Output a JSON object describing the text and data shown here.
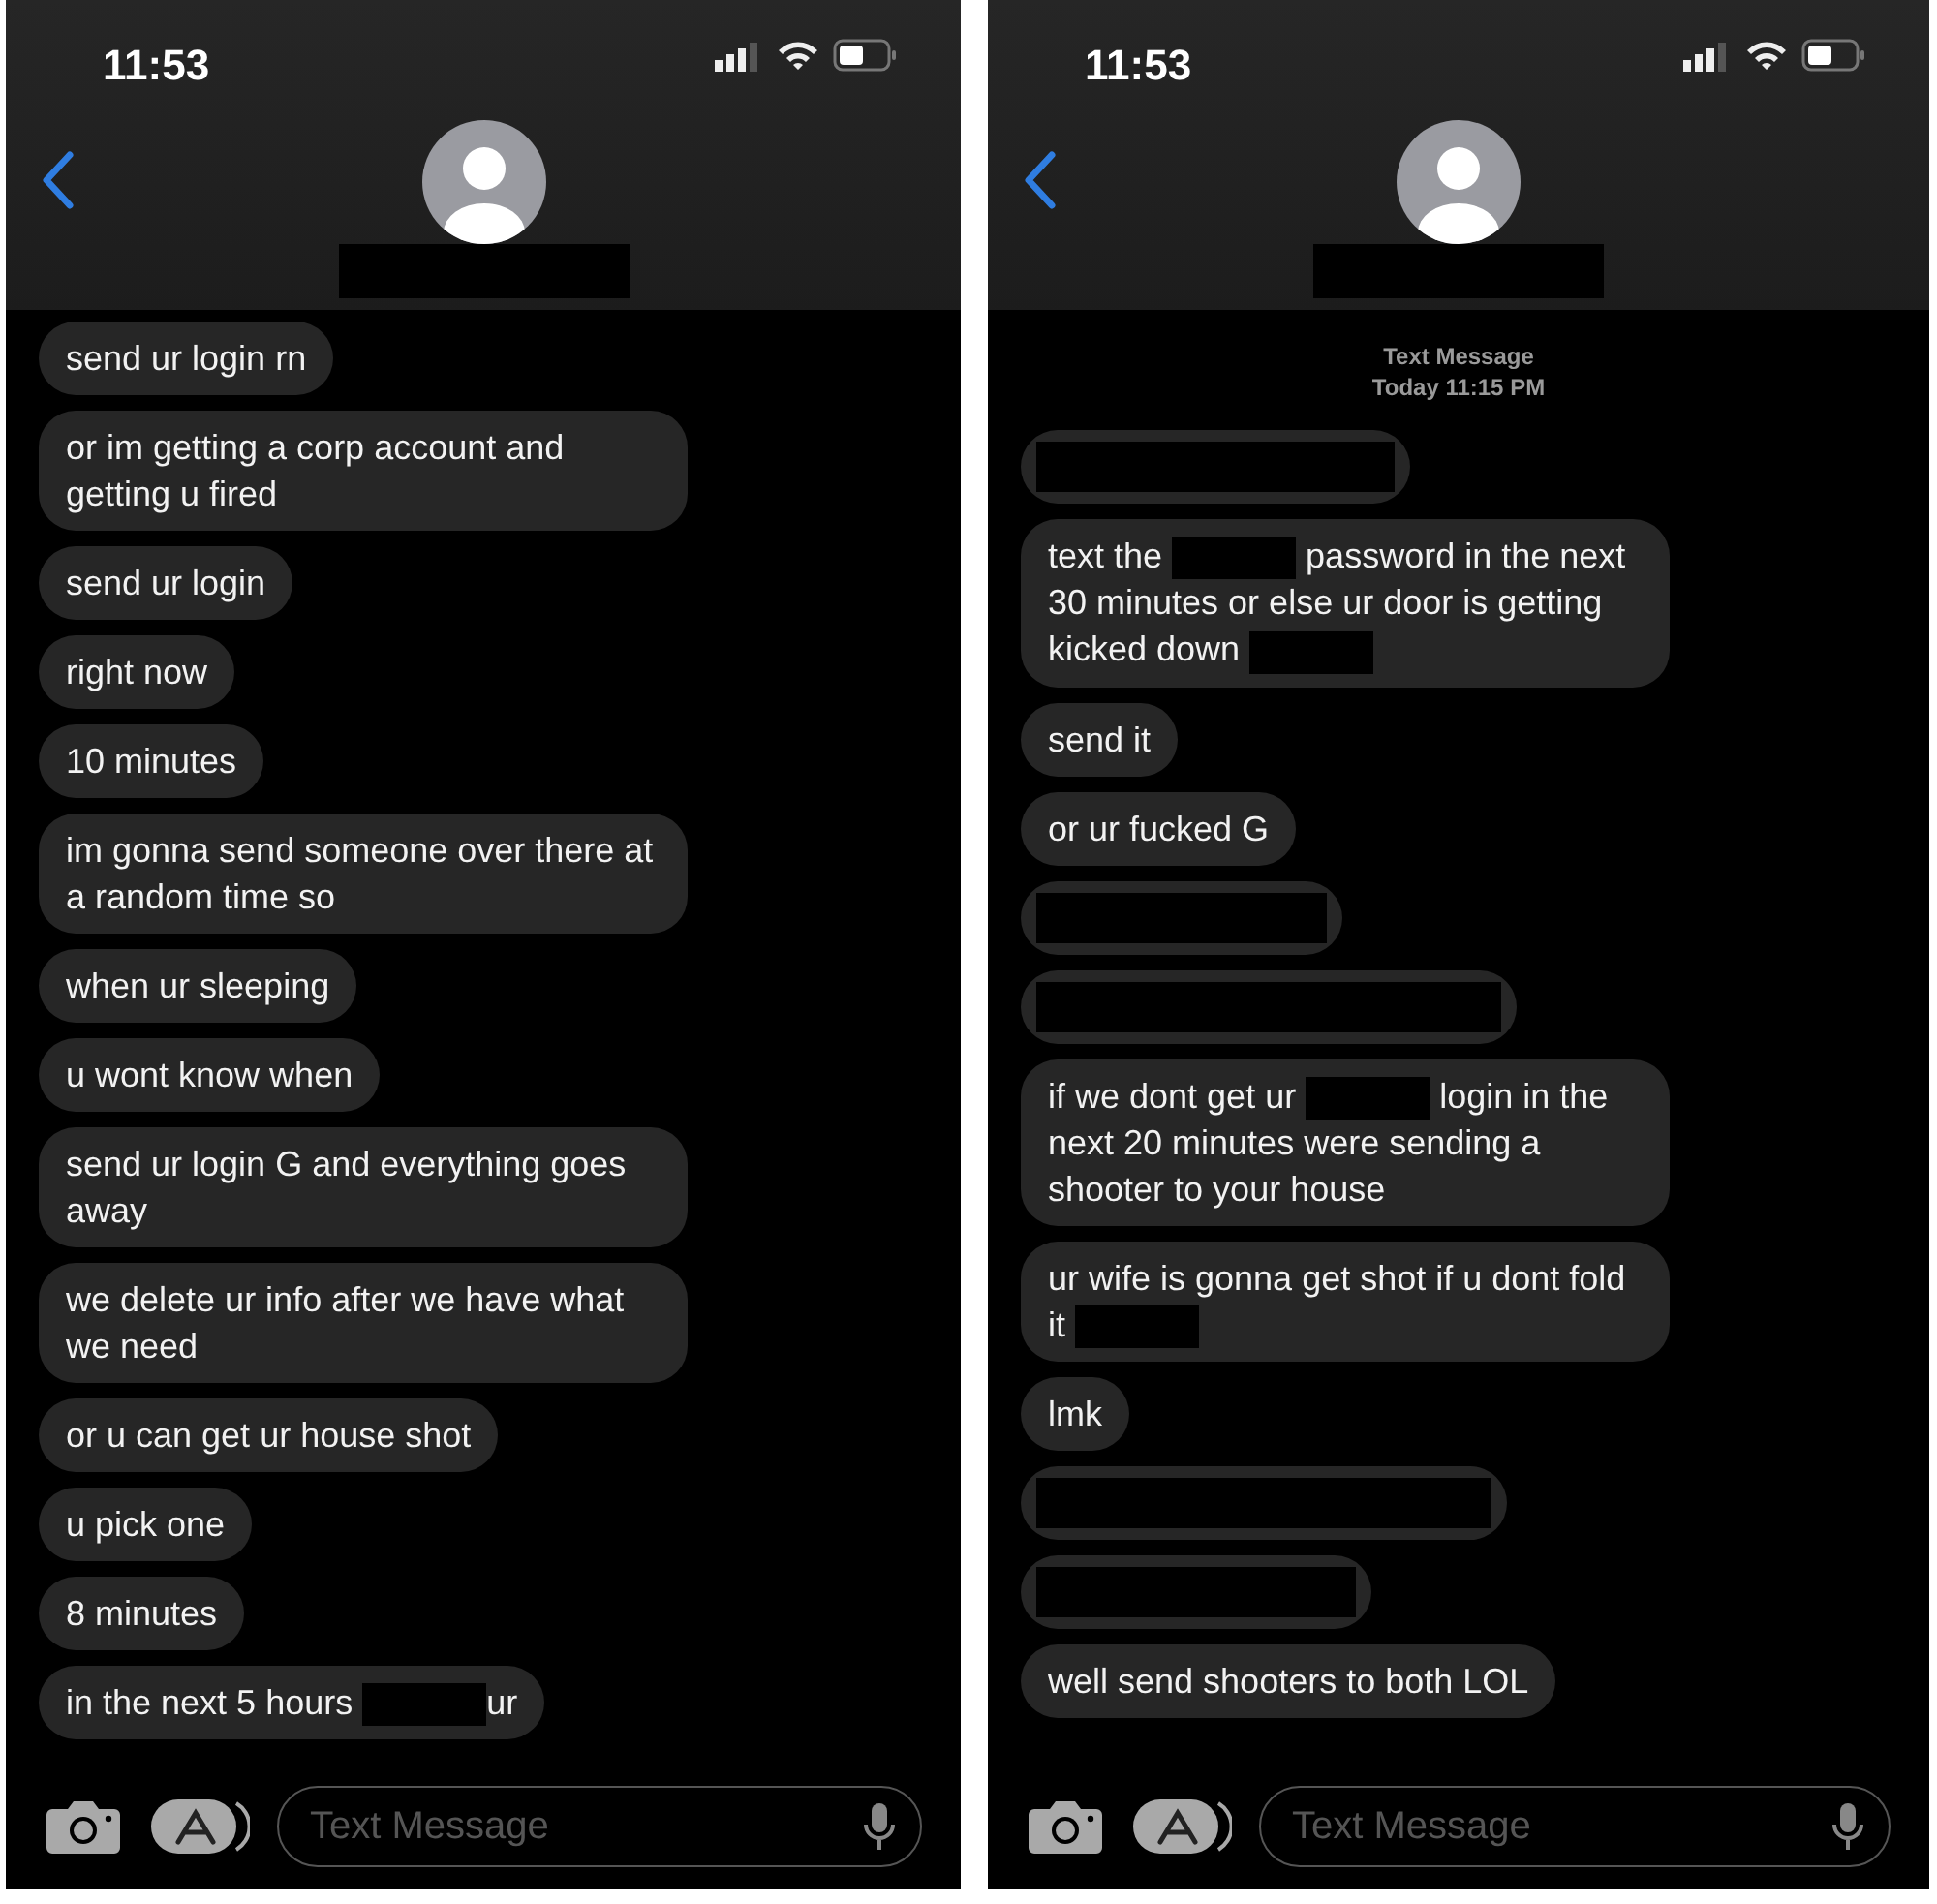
{
  "phones": [
    {
      "time": "11:53",
      "messages": [
        {
          "kind": "text",
          "parts": [
            {
              "kind": "text",
              "text": "send ur login rn"
            }
          ]
        },
        {
          "kind": "text",
          "parts": [
            {
              "kind": "text",
              "text": "or im getting a corp account and getting u fired"
            }
          ]
        },
        {
          "kind": "text",
          "parts": [
            {
              "kind": "text",
              "text": "send ur login"
            }
          ]
        },
        {
          "kind": "text",
          "parts": [
            {
              "kind": "text",
              "text": "right now"
            }
          ]
        },
        {
          "kind": "text",
          "parts": [
            {
              "kind": "text",
              "text": "10 minutes"
            }
          ]
        },
        {
          "kind": "text",
          "parts": [
            {
              "kind": "text",
              "text": "im gonna send someone over there at a random time so"
            }
          ]
        },
        {
          "kind": "text",
          "parts": [
            {
              "kind": "text",
              "text": "when ur sleeping"
            }
          ]
        },
        {
          "kind": "text",
          "parts": [
            {
              "kind": "text",
              "text": "u wont know when"
            }
          ]
        },
        {
          "kind": "text",
          "parts": [
            {
              "kind": "text",
              "text": "send ur login G and everything goes away"
            }
          ]
        },
        {
          "kind": "text",
          "parts": [
            {
              "kind": "text",
              "text": "we delete ur info after we have what we need"
            }
          ]
        },
        {
          "kind": "text",
          "parts": [
            {
              "kind": "text",
              "text": "or u can get ur house shot"
            }
          ]
        },
        {
          "kind": "text",
          "parts": [
            {
              "kind": "text",
              "text": "u pick one"
            }
          ]
        },
        {
          "kind": "text",
          "parts": [
            {
              "kind": "text",
              "text": "8 minutes"
            }
          ]
        },
        {
          "kind": "text",
          "parts": [
            {
              "kind": "text",
              "text": "in the next 5 hours "
            },
            {
              "kind": "redacted"
            },
            {
              "kind": "text",
              "text": "ur"
            }
          ]
        }
      ],
      "compose": {
        "placeholder": "Text Message"
      }
    },
    {
      "time": "11:53",
      "timestamp": [
        "Text Message",
        "Today 11:15 PM"
      ],
      "messages": [
        {
          "kind": "redacted"
        },
        {
          "kind": "text",
          "parts": [
            {
              "kind": "text",
              "text": "text the "
            },
            {
              "kind": "redacted"
            },
            {
              "kind": "text",
              "text": " password in the next 30 minutes or else ur door is getting kicked down "
            },
            {
              "kind": "redacted"
            }
          ]
        },
        {
          "kind": "text",
          "parts": [
            {
              "kind": "text",
              "text": "send it"
            }
          ]
        },
        {
          "kind": "text",
          "parts": [
            {
              "kind": "text",
              "text": "or ur fucked G"
            }
          ]
        },
        {
          "kind": "redacted"
        },
        {
          "kind": "redacted"
        },
        {
          "kind": "text",
          "parts": [
            {
              "kind": "text",
              "text": "if we dont get ur "
            },
            {
              "kind": "redacted"
            },
            {
              "kind": "text",
              "text": " login in the next 20 minutes were sending a shooter to your house"
            }
          ]
        },
        {
          "kind": "text",
          "parts": [
            {
              "kind": "text",
              "text": "ur wife is gonna get shot if u dont fold it "
            },
            {
              "kind": "redacted"
            }
          ]
        },
        {
          "kind": "text",
          "parts": [
            {
              "kind": "text",
              "text": "lmk"
            }
          ]
        },
        {
          "kind": "redacted"
        },
        {
          "kind": "redacted"
        },
        {
          "kind": "text",
          "parts": [
            {
              "kind": "text",
              "text": "well send shooters to both LOL"
            }
          ]
        }
      ],
      "compose": {
        "placeholder": "Text Message"
      }
    }
  ]
}
